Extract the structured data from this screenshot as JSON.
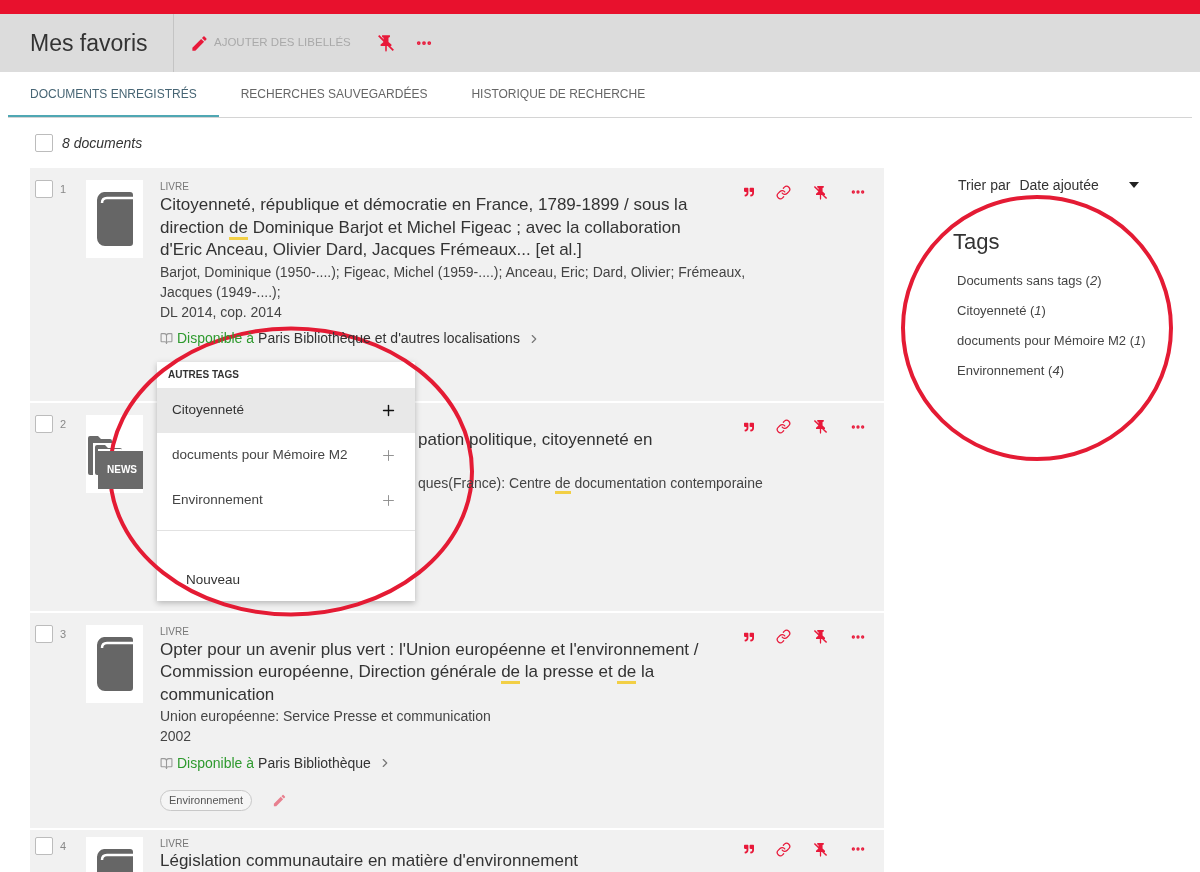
{
  "header": {
    "title": "Mes favoris",
    "actions": [
      {
        "kind": "edit",
        "label": "AJOUTER DES LIBELLÉS",
        "disabled": true
      },
      {
        "kind": "unpin"
      },
      {
        "kind": "more"
      }
    ]
  },
  "tabs": [
    {
      "label": "DOCUMENTS ENREGISTRÉS",
      "selected": true
    },
    {
      "label": "RECHERCHES SAUVEGARDÉES",
      "selected": false
    },
    {
      "label": "HISTORIQUE DE RECHERCHE",
      "selected": false
    }
  ],
  "select_all": {
    "label": "8 documents",
    "checked": false
  },
  "documents": [
    {
      "number": "1",
      "checked": false,
      "kind": "book",
      "type": "LIVRE",
      "title": [
        {
          "text": "Citoyenneté, république et démocratie en France, 1789-1899 / sous la direction ",
          "marked": false
        },
        {
          "text": "de",
          "marked": true
        },
        {
          "text": " Dominique Barjot et Michel Figeac ; avec la collaboration d'Eric Anceau, Olivier Dard, Jacques Frémeaux... [et al.]",
          "marked": false
        }
      ],
      "authors": [
        {
          "text": "Barjot, Dominique (1950-....); Figeac, Michel (1959-....); Anceau, Eric; Dard, Olivier; Frémeaux, Jacques (1949-....);",
          "marked": false
        }
      ],
      "date": "DL 2014, cop. 2014",
      "availability": {
        "available": true,
        "status": "Disponible à",
        "location": "Paris Bibliothèque et d'autres localisations"
      },
      "tag_menu": {
        "heading": "AUTRES TAGS",
        "items": [
          {
            "label": "Citoyenneté",
            "highlighted": true
          },
          {
            "label": "documents pour Mémoire M2",
            "highlighted": false
          },
          {
            "label": "Environnement",
            "highlighted": false
          }
        ],
        "new_label": "Nouveau",
        "circled": true
      }
    },
    {
      "number": "2",
      "checked": false,
      "kind": "news",
      "thumb_label": "NEWS",
      "title": [
        {
          "text": "pation politique, citoyenneté en",
          "marked": false
        }
      ],
      "authors": [
        {
          "text": "ques(France): Centre ",
          "marked": false
        },
        {
          "text": "de",
          "marked": true
        },
        {
          "text": " documentation contemporaine",
          "marked": false
        }
      ]
    },
    {
      "number": "3",
      "checked": false,
      "kind": "book",
      "type": "LIVRE",
      "title": [
        {
          "text": "Opter pour un avenir plus vert : l'Union européenne et l'environnement / Commission européenne, Direction générale ",
          "marked": false
        },
        {
          "text": "de",
          "marked": true
        },
        {
          "text": " la presse et ",
          "marked": false
        },
        {
          "text": "de",
          "marked": true
        },
        {
          "text": " la communication",
          "marked": false
        }
      ],
      "authors": [
        {
          "text": "Union européenne: Service Presse et communication",
          "marked": false
        }
      ],
      "date": "2002",
      "availability": {
        "available": true,
        "status": "Disponible à",
        "location": "Paris Bibliothèque"
      },
      "tags": [
        "Environnement"
      ]
    },
    {
      "number": "4",
      "checked": false,
      "kind": "book",
      "type": "LIVRE",
      "title": [
        {
          "text": "Législation communautaire en matière d'environnement",
          "marked": false
        }
      ]
    }
  ],
  "sort": {
    "label": "Trier par",
    "value": "Date ajoutée"
  },
  "tags_panel": {
    "heading": "Tags",
    "items": [
      "Documents sans tags (*2*)",
      "Citoyenneté (*1*)",
      "documents pour Mémoire M2 (*1*)",
      "Environnement (*4*)"
    ],
    "circled": true
  }
}
